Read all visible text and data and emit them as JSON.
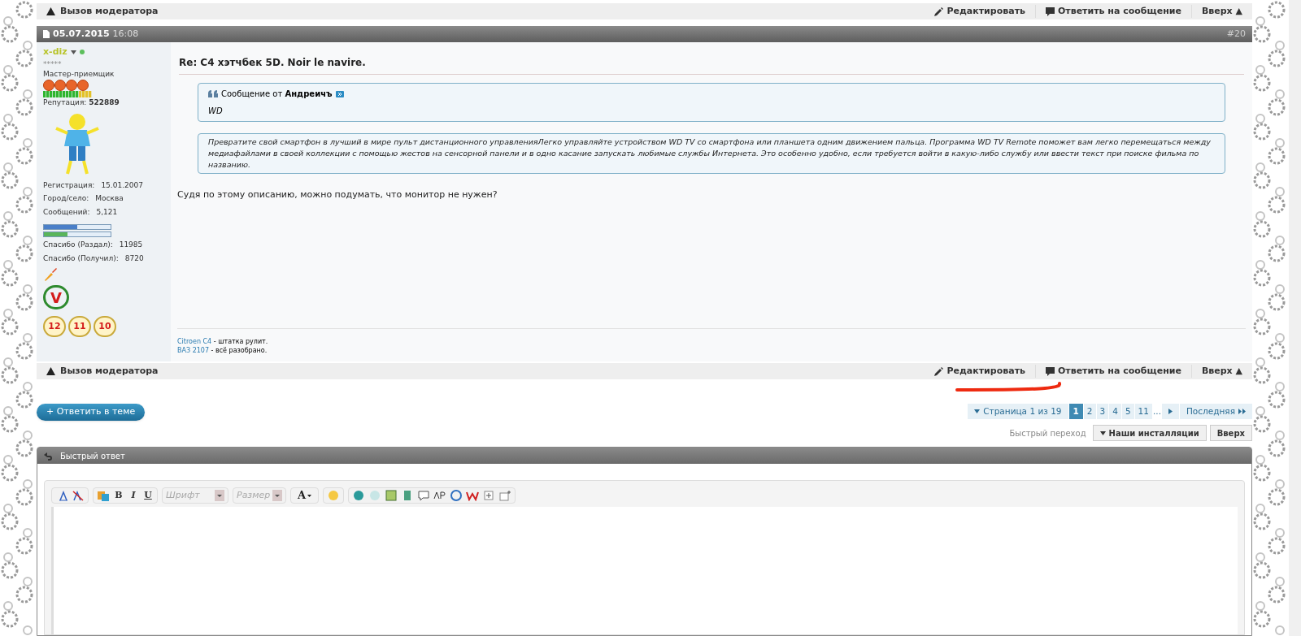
{
  "top_bar": {
    "report": "Вызов модератора",
    "edit": "Редактировать",
    "reply": "Ответить на сообщение",
    "top": "Вверх ▲"
  },
  "post": {
    "date": "05.07.2015",
    "time": "16:08",
    "number": "#20",
    "user": {
      "name": "x-diz",
      "online": true,
      "stars_text": "*****",
      "rank": "Мастер-приемщик",
      "reputation_label": "Репутация:",
      "reputation": "522889",
      "info": [
        {
          "label": "Регистрация:",
          "value": "15.01.2007"
        },
        {
          "label": "Город/село:",
          "value": "Москва"
        },
        {
          "label": "Сообщений:",
          "value": "5,121"
        }
      ],
      "bars": [
        {
          "level": 0.5,
          "color": "#4a7fc8"
        },
        {
          "level": 0.35,
          "color": "#5ab55a"
        }
      ],
      "thanks": [
        {
          "label": "Спасибо (Раздал):",
          "value": "11985"
        },
        {
          "label": "Спасибо (Получил):",
          "value": "8720"
        }
      ],
      "laurel": "V",
      "awards": [
        "12",
        "11",
        "10"
      ]
    },
    "title": "Re: C4 хэтчбек 5D. Noir le navire.",
    "quote": {
      "prefix": "Сообщение от",
      "author": "Андреичъ",
      "text": "WD"
    },
    "quote2": "Превратите свой смартфон в лучший в мире пульт дистанционного управленияЛегко управляйте устройством WD TV со смартфона или планшета одним движением пальца. Программа WD TV Remote поможет вам легко перемещаться между медиафайлами в своей коллекции с помощью жестов на сенсорной панели и в одно касание запускать любимые службы Интернета. Это особенно удобно, если требуется войти в какую-либо службу или ввести текст при поиске фильма по названию.",
    "body": "Судя по этому описанию, можно подумать, что монитор не нужен?",
    "signature": [
      {
        "link": "Citroen C4",
        "text": " - штатка рулит."
      },
      {
        "link": "ВАЗ 2107",
        "text": " - всё разобрано."
      }
    ]
  },
  "bottom_bar": {
    "report": "Вызов модератора",
    "edit": "Редактировать",
    "reply": "Ответить на сообщение",
    "top": "Вверх ▲"
  },
  "reply_button": "+ Ответить в теме",
  "pagination": {
    "label": "Страница 1 из 19",
    "pages": [
      {
        "label": "1",
        "selected": true
      },
      {
        "label": "2",
        "selected": false
      },
      {
        "label": "3",
        "selected": false
      },
      {
        "label": "4",
        "selected": false
      },
      {
        "label": "5",
        "selected": false
      },
      {
        "label": "11",
        "selected": false
      }
    ],
    "ellipsis": "...",
    "last": "Последняя"
  },
  "quick_nav": {
    "label": "Быстрый переход",
    "forum": "Наши инсталляции",
    "top": "Вверх"
  },
  "quick_reply": {
    "title": "Быстрый ответ",
    "font": "Шрифт",
    "size": "Размер",
    "bold": "B",
    "italic": "I",
    "underline": "U",
    "text_color_letter": "A"
  }
}
